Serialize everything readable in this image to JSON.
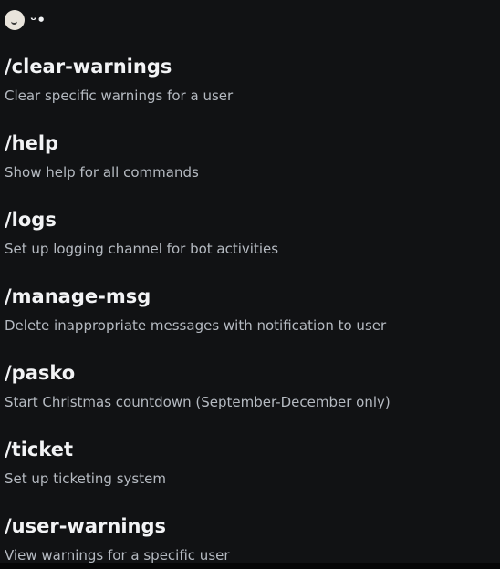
{
  "header": {
    "avatar_icon": "smiley-avatar-icon",
    "bot_name": "ᵕ•"
  },
  "commands": [
    {
      "name": "/clear-warnings",
      "description": "Clear specific warnings for a user"
    },
    {
      "name": "/help",
      "description": "Show help for all commands"
    },
    {
      "name": "/logs",
      "description": "Set up logging channel for bot activities"
    },
    {
      "name": "/manage-msg",
      "description": "Delete inappropriate messages with notification to user"
    },
    {
      "name": "/pasko",
      "description": "Start Christmas countdown (September-December only)"
    },
    {
      "name": "/ticket",
      "description": "Set up ticketing system"
    },
    {
      "name": "/user-warnings",
      "description": "View warnings for a specific user"
    }
  ],
  "colors": {
    "background": "#111214",
    "title": "#f2f3f5",
    "description": "#b5bac1"
  }
}
